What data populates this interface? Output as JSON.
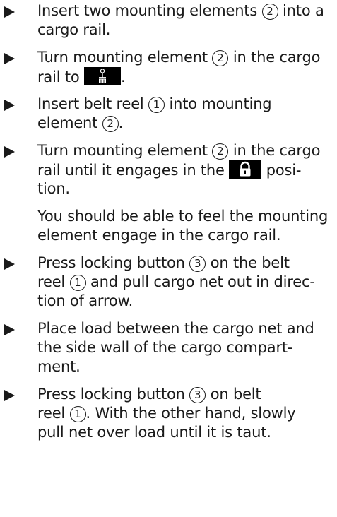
{
  "steps": [
    {
      "lines": [
        {
          "a": "Insert two mounting elements ",
          "n": "2",
          "b": " into a"
        },
        {
          "a": "cargo rail."
        }
      ]
    },
    {
      "lines": [
        {
          "a": "Turn mounting element ",
          "n": "2",
          "b": " in the cargo"
        },
        {
          "a": "rail to ",
          "icon": "unlock-symbol-icon",
          "b": "."
        }
      ]
    },
    {
      "lines": [
        {
          "a": "Insert belt reel ",
          "n": "1",
          "b": " into mounting"
        },
        {
          "a": "element ",
          "n": "2",
          "b": "."
        }
      ]
    },
    {
      "lines": [
        {
          "a": "Turn mounting element ",
          "n": "2",
          "b": " in the cargo"
        },
        {
          "a": "rail until it engages in the ",
          "icon": "lock-symbol-icon",
          "b": " posi-"
        },
        {
          "a": "tion."
        }
      ]
    },
    {
      "lines": [
        {
          "a": "Press locking button ",
          "n": "3",
          "b": " on the belt"
        },
        {
          "a": "reel ",
          "n": "1",
          "b": " and pull cargo net out in direc-"
        },
        {
          "a": "tion of arrow."
        }
      ]
    },
    {
      "lines": [
        {
          "a": "Place load between the cargo net and"
        },
        {
          "a": "the side wall of the cargo compart-"
        },
        {
          "a": "ment."
        }
      ]
    },
    {
      "lines": [
        {
          "a": "Press locking button ",
          "n": "3",
          "b": " on belt"
        },
        {
          "a": "reel ",
          "n": "1",
          "b": ". With the other hand, slowly"
        },
        {
          "a": "pull net over load until it is taut."
        }
      ]
    }
  ],
  "note": {
    "lines": [
      "You should be able to feel the mounting",
      "element engage in the cargo rail."
    ]
  }
}
